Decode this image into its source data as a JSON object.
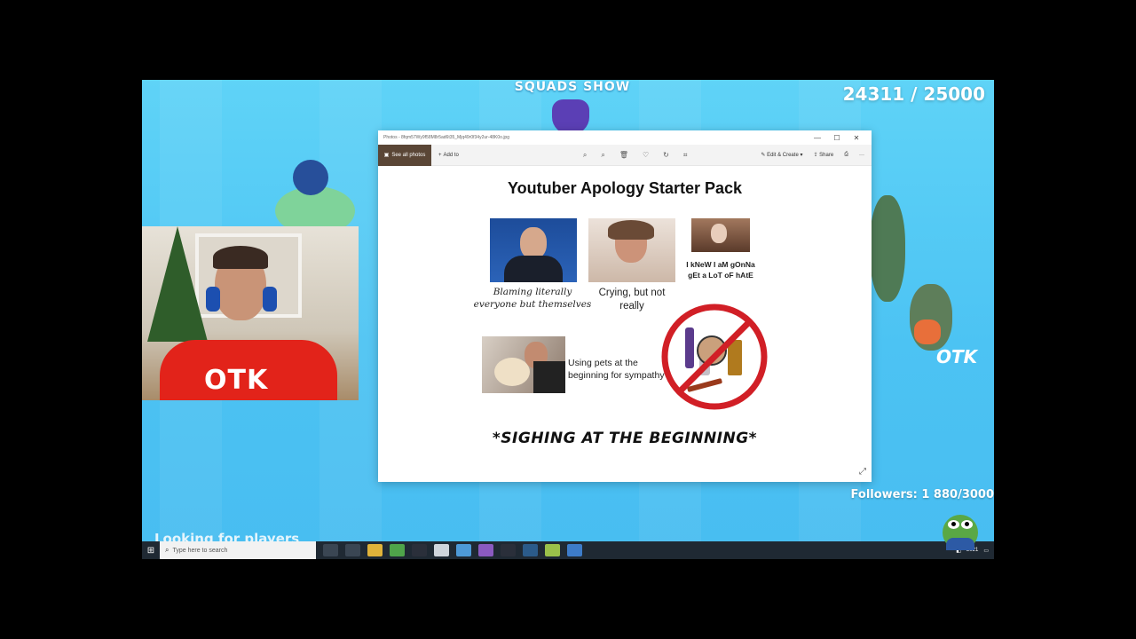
{
  "stream": {
    "squads_title": "SQUADS SHOW",
    "counter": "24311 / 25000",
    "followers": "Followers: 1 880/3000",
    "looking": "Looking for players",
    "logo_text": "OTK",
    "webcam_shirt_text": "OTK"
  },
  "photos_app": {
    "title": "Photos - 8fqm57Wy9f58M8r5ad6t35_Mjq49r0f34y2ur-48K0o.jpg",
    "see_all_photos": "See all photos",
    "add_to": "Add to",
    "edit_create": "Edit & Create",
    "share": "Share",
    "minimize": "—",
    "maximize": "☐",
    "close": "✕"
  },
  "meme": {
    "title": "Youtuber Apology Starter Pack",
    "caption_blaming": "Blaming literally everyone but themselves",
    "caption_crying": "Crying, but not really",
    "caption_hate": "I kNeW I aM gOnNa gEt a LoT oF hAtE",
    "caption_pets": "Using pets at the beginning for sympathy",
    "caption_sighing": "*SIGHING AT THE BEGINNING*"
  },
  "taskbar": {
    "search_placeholder": "Type here to search",
    "date": "2021"
  },
  "icons": {
    "start": "windows-logo-icon",
    "search": "search-icon",
    "photos": "image-icon",
    "expand": "expand-icon"
  },
  "colors": {
    "background_blue": "#4cc3f3",
    "otk_red": "#e2231a",
    "photos_brown": "#5a4636",
    "no_sign_red": "#d11f26",
    "taskbar": "#1f2933"
  }
}
